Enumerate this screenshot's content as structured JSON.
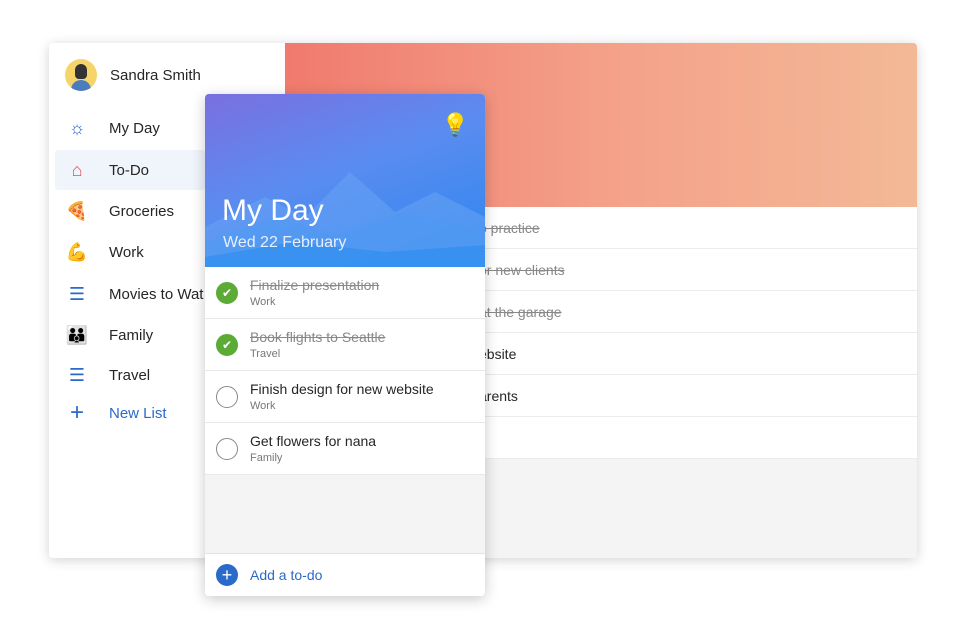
{
  "user": {
    "name": "Sandra Smith"
  },
  "sidebar": {
    "items": [
      {
        "label": "My Day",
        "icon": "sun-icon",
        "glyph": "☼"
      },
      {
        "label": "To-Do",
        "icon": "house-check-icon",
        "glyph": "⌂"
      },
      {
        "label": "Groceries",
        "icon": "pizza-icon",
        "glyph": "🍕"
      },
      {
        "label": "Work",
        "icon": "flexed-biceps-icon",
        "glyph": "💪"
      },
      {
        "label": "Movies to Wat",
        "icon": "list-icon",
        "glyph": "☰"
      },
      {
        "label": "Family",
        "icon": "family-icon",
        "glyph": "👪"
      },
      {
        "label": "Travel",
        "icon": "list-icon",
        "glyph": "☰"
      }
    ],
    "new_list": "New List"
  },
  "background_list": {
    "rows": [
      {
        "text": "o practice",
        "done": true
      },
      {
        "text": "or new clients",
        "done": true
      },
      {
        "text": "at the garage",
        "done": true
      },
      {
        "text": "ebsite",
        "done": false
      },
      {
        "text": "arents",
        "done": false
      },
      {
        "text": "",
        "done": false
      }
    ]
  },
  "my_day": {
    "title": "My Day",
    "date": "Wed 22 February",
    "tasks": [
      {
        "title": "Finalize presentation",
        "list": "Work",
        "done": true
      },
      {
        "title": "Book flights to Seattle",
        "list": "Travel",
        "done": true
      },
      {
        "title": "Finish design for new website",
        "list": "Work",
        "done": false
      },
      {
        "title": "Get flowers for nana",
        "list": "Family",
        "done": false
      }
    ],
    "add_label": "Add a to-do"
  },
  "colors": {
    "accent": "#2a6ac8",
    "check": "#5cab36"
  }
}
